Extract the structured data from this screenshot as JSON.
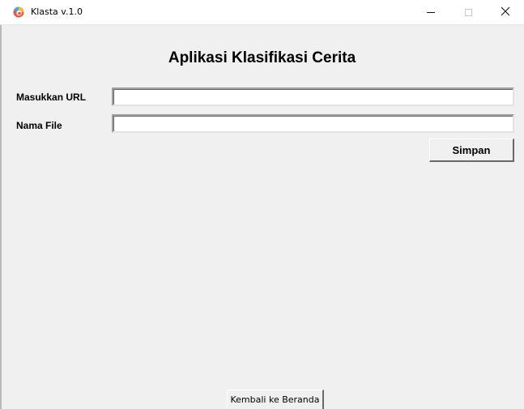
{
  "window": {
    "title": "Klasta v.1.0",
    "icon": "app-logo-icon",
    "controls": {
      "minimize": "minimize-icon",
      "maximize": "maximize-icon",
      "close": "close-icon",
      "close_glyph": "✕"
    }
  },
  "main": {
    "heading": "Aplikasi Klasifikasi Cerita",
    "form": {
      "url_label": "Masukkan URL",
      "url_value": "",
      "filename_label": "Nama File",
      "filename_value": ""
    },
    "save_button": "Simpan",
    "back_button": "Kembali ke Beranda"
  },
  "colors": {
    "background": "#f0f0f0",
    "titlebar": "#ffffff",
    "text": "#000000"
  }
}
